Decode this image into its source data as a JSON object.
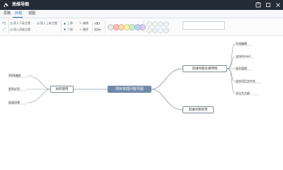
{
  "window": {
    "title": "思维导图"
  },
  "menu": {
    "items": [
      "思路",
      "外观",
      "视图"
    ],
    "active_index": 1
  },
  "toolbar": {
    "insert_child": "插入下级主题",
    "insert_parent": "插入上级主题",
    "insert_sibling": "插入同级主题",
    "move_up": "上移",
    "move_down": "下移",
    "edit": "编辑",
    "delete": "删除",
    "link_label": "链接",
    "priority_colors": [
      "#e8e8e8",
      "#ffb8b8",
      "#ffd9a8",
      "#fff0a8",
      "#c8f0c0",
      "#b8d8f8",
      "#d8c8f0"
    ],
    "progress_colors": [
      "#f3f3f3",
      "#f0f6e8",
      "#e8f4f8",
      "#f4f0f8",
      "#faf3e8",
      "#eef0f3",
      "#f6f6f6",
      "#f0f0f0"
    ],
    "search_placeholder": ""
  },
  "mindmap": {
    "root": "项目管理问答导图",
    "left": {
      "label": "如何使用",
      "children": [
        "WEB端图",
        "更多好用",
        "极速创建"
      ]
    },
    "right": [
      {
        "label": "思维导图主要特性",
        "children": [
          "在线编辑",
          "支持Xmind",
          "版本管理",
          "组合项目文件夹",
          "导出为大纲"
        ]
      },
      {
        "label": "思维导图优势",
        "children": []
      }
    ]
  }
}
